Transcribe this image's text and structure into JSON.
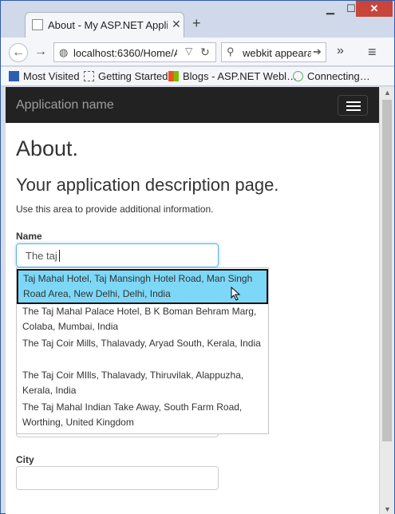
{
  "browser": {
    "tab_title": "About - My ASP.NET Appli",
    "new_tab": "+",
    "url": "localhost:6360/Home/Abo",
    "search_text": "webkit appearai",
    "bookmarks": [
      "Most Visited",
      "Getting Started",
      "Blogs - ASP.NET Webl…",
      "Connecting…"
    ]
  },
  "app": {
    "brand": "Application name",
    "page_title": "About.",
    "subtitle": "Your application description page.",
    "info": "Use this area to provide additional information."
  },
  "form": {
    "name_label": "Name",
    "name_value": "The taj",
    "city_label": "City",
    "city_value": ""
  },
  "autocomplete": {
    "items": [
      {
        "text": "Taj Mahal Hotel, Taj Mansingh Hotel Road, Man Singh Road Area, New Delhi, Delhi, India"
      },
      {
        "text": "The Taj Mahal Palace Hotel, B K Boman Behram Marg, Colaba, Mumbai, India"
      },
      {
        "text": "The Taj Coir Mills, Thalavady, Aryad South, Kerala, India"
      },
      {
        "text": "The Taj Coir MIlls, Thalavady, Thiruvilak, Alappuzha, Kerala, India"
      },
      {
        "text": "The Taj Mahal Indian Take Away, South Farm Road, Worthing, United Kingdom"
      }
    ],
    "active_index": 0,
    "active_color": "#7dd8f7"
  },
  "icons": {
    "back": "back-arrow-icon",
    "forward": "forward-arrow-icon",
    "reload": "reload-icon",
    "search": "search-icon",
    "menu": "hamburger-menu-icon"
  }
}
